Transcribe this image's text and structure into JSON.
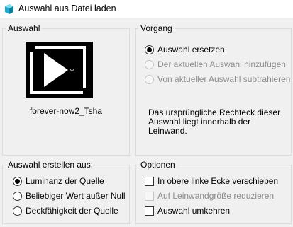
{
  "window": {
    "title": "Auswahl aus Datei laden",
    "icon": "app-icon"
  },
  "auswahl": {
    "title": "Auswahl",
    "filename": "forever-now2_Tsha"
  },
  "vorgang": {
    "title": "Vorgang",
    "options": [
      {
        "label": "Auswahl ersetzen",
        "checked": true,
        "enabled": true
      },
      {
        "label": "Der aktuellen Auswahl hinzufügen",
        "checked": false,
        "enabled": false
      },
      {
        "label": "Von aktueller Auswahl subtrahieren",
        "checked": false,
        "enabled": false
      }
    ],
    "description": "Das ursprüngliche Rechteck dieser Auswahl liegt innerhalb der Leinwand."
  },
  "erstellen": {
    "title": "Auswahl erstellen aus:",
    "options": [
      {
        "label": "Luminanz der Quelle",
        "checked": true
      },
      {
        "label": "Beliebiger Wert außer Null",
        "checked": false
      },
      {
        "label": "Deckfähigkeit der Quelle",
        "checked": false
      }
    ]
  },
  "optionen": {
    "title": "Optionen",
    "options": [
      {
        "label": "In obere linke Ecke verschieben",
        "checked": false,
        "enabled": true
      },
      {
        "label": "Auf Leinwandgröße reduzieren",
        "checked": false,
        "enabled": false
      },
      {
        "label": "Auswahl umkehren",
        "checked": false,
        "enabled": true
      }
    ]
  },
  "colors": {
    "accent": "#1fa8c9",
    "group_border": "#dcdcdc",
    "disabled_text": "#8c8c8c"
  }
}
